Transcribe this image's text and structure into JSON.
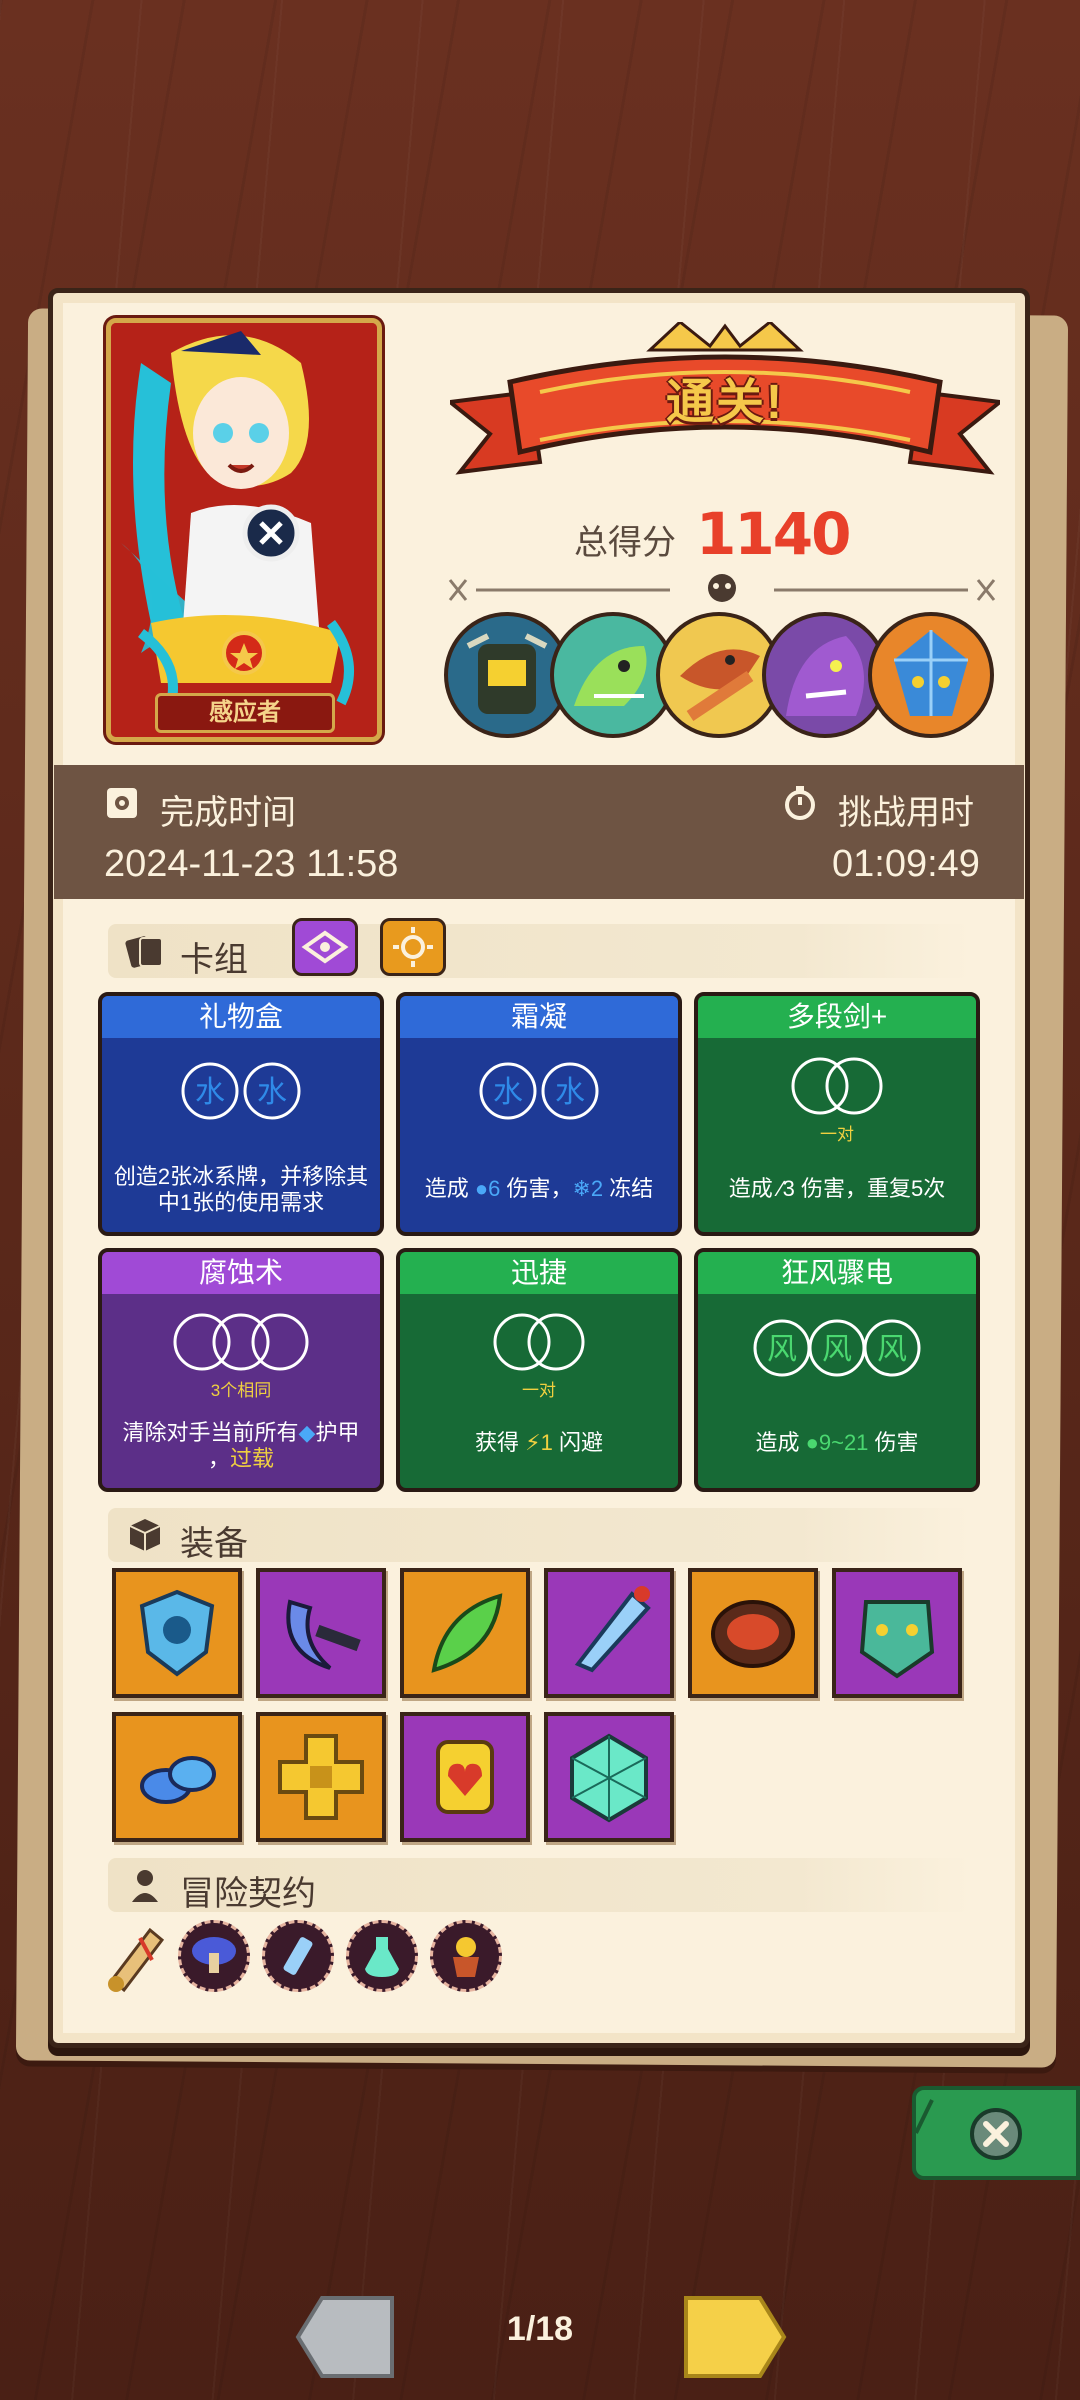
{
  "character": {
    "name": "感应者"
  },
  "result": {
    "banner": "通关!",
    "score_label": "总得分",
    "score_value": "1140"
  },
  "time": {
    "finish_label": "完成时间",
    "finish_value": "2024-11-23 11:58",
    "challenge_label": "挑战用时",
    "challenge_value": "01:09:49"
  },
  "deck": {
    "title": "卡组",
    "cards": [
      {
        "name": "礼物盒",
        "desc": "创造2张冰系牌，并移除其中1张的使用需求",
        "color": "blue",
        "slot_note": ""
      },
      {
        "name": "霜凝",
        "desc_parts": [
          "造成 ",
          "6",
          " 伤害，",
          "2",
          " 冻结"
        ],
        "color": "blue",
        "slot_note": ""
      },
      {
        "name": "多段剑+",
        "desc_parts": [
          "造成 ",
          "3",
          " 伤害，重复5次"
        ],
        "color": "green",
        "slot_note": "一对"
      },
      {
        "name": "腐蚀术",
        "desc_parts": [
          "清除对手当前所有",
          "护甲",
          "，",
          "过载"
        ],
        "color": "purple",
        "slot_note": "3个相同"
      },
      {
        "name": "迅捷",
        "desc_parts": [
          "获得 ",
          "1",
          " 闪避"
        ],
        "color": "green",
        "slot_note": "一对"
      },
      {
        "name": "狂风骤电",
        "desc_parts": [
          "造成 ",
          "9~21",
          " 伤害"
        ],
        "color": "green",
        "slot_note": ""
      }
    ]
  },
  "equipment": {
    "title": "装备",
    "items": [
      {
        "icon": "ice-shield-icon",
        "bg": "orange"
      },
      {
        "icon": "crescent-blade-icon",
        "bg": "violet"
      },
      {
        "icon": "green-feather-icon",
        "bg": "orange"
      },
      {
        "icon": "ice-dagger-icon",
        "bg": "violet"
      },
      {
        "icon": "lava-stone-icon",
        "bg": "orange"
      },
      {
        "icon": "demon-mask-icon",
        "bg": "violet"
      },
      {
        "icon": "blue-jelly-icon",
        "bg": "orange"
      },
      {
        "icon": "golden-cross-icon",
        "bg": "orange"
      },
      {
        "icon": "heart-charm-icon",
        "bg": "violet"
      },
      {
        "icon": "crystal-d20-icon",
        "bg": "violet"
      }
    ]
  },
  "contract": {
    "title": "冒险契约"
  },
  "pagination": {
    "counter": "1/18"
  },
  "colors": {
    "accent_red": "#e8402a",
    "blue_card": "#1e3a96",
    "green_card": "#176a36",
    "purple_card": "#5c2f88"
  }
}
